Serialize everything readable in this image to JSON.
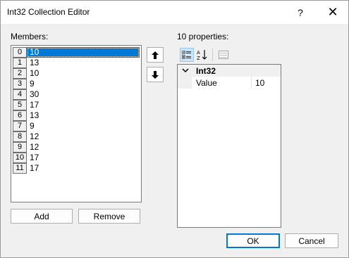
{
  "window": {
    "title": "Int32 Collection Editor",
    "help_label": "?",
    "close_label": "✕"
  },
  "members": {
    "label": "Members:",
    "items": [
      {
        "index": "0",
        "value": "10"
      },
      {
        "index": "1",
        "value": "13"
      },
      {
        "index": "2",
        "value": "10"
      },
      {
        "index": "3",
        "value": "9"
      },
      {
        "index": "4",
        "value": "30"
      },
      {
        "index": "5",
        "value": "17"
      },
      {
        "index": "6",
        "value": "13"
      },
      {
        "index": "7",
        "value": "9"
      },
      {
        "index": "8",
        "value": "12"
      },
      {
        "index": "9",
        "value": "12"
      },
      {
        "index": "10",
        "value": "17"
      },
      {
        "index": "11",
        "value": "17"
      }
    ],
    "selected_index": 0
  },
  "buttons": {
    "add": "Add",
    "remove": "Remove",
    "ok": "OK",
    "cancel": "Cancel"
  },
  "properties": {
    "label": "10 properties:",
    "category": "Int32",
    "row_name": "Value",
    "row_value": "10"
  },
  "colors": {
    "selection": "#0078d7",
    "default_button_border": "#0078d7"
  }
}
